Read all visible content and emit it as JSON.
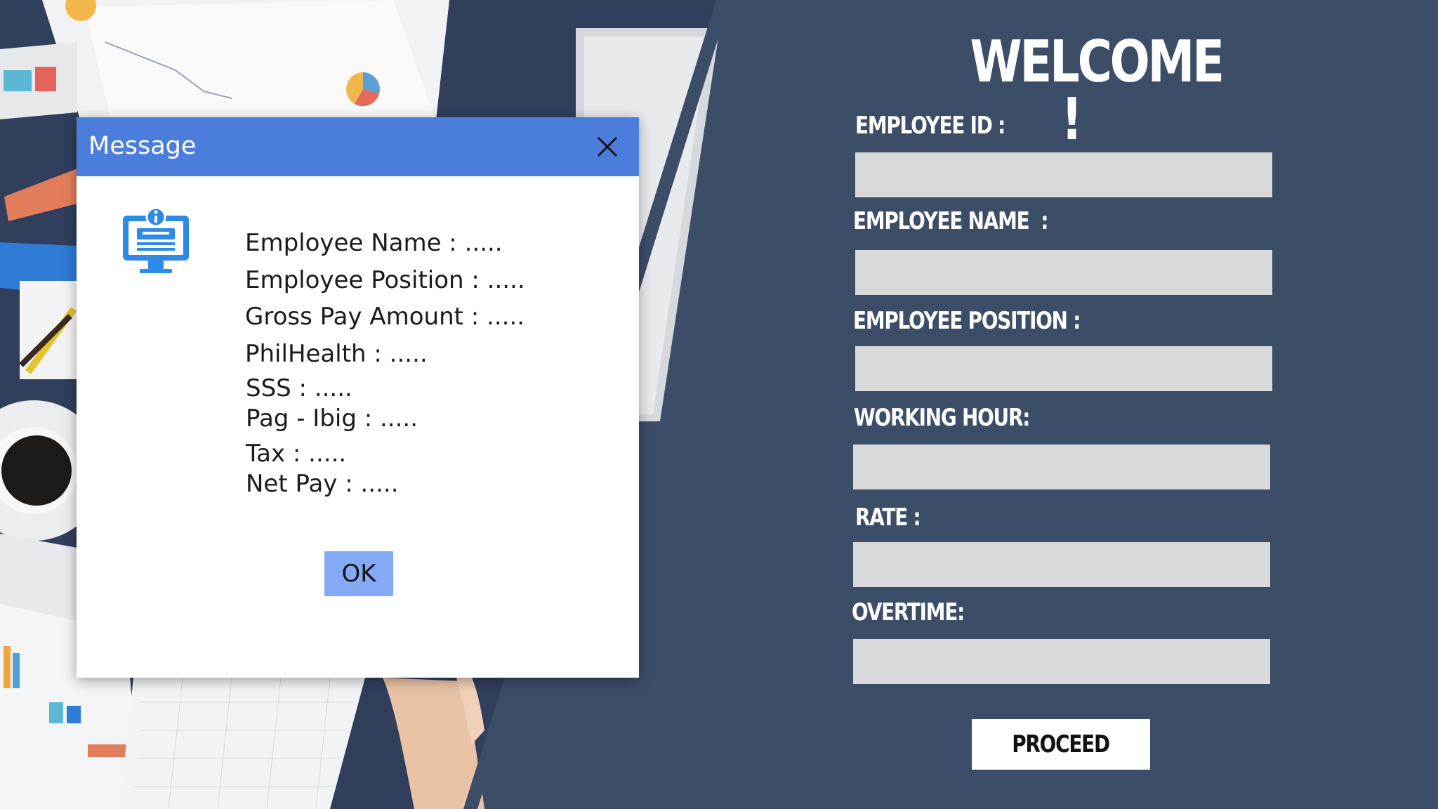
{
  "form": {
    "heading": "WELCOME !",
    "fields": [
      {
        "label": "EMPLOYEE ID :",
        "value": ""
      },
      {
        "label": "EMPLOYEE NAME  :",
        "value": ""
      },
      {
        "label": "EMPLOYEE POSITION :",
        "value": ""
      },
      {
        "label": "WORKING HOUR:",
        "value": ""
      },
      {
        "label": "RATE :",
        "value": ""
      },
      {
        "label": "OVERTIME:",
        "value": ""
      }
    ],
    "proceed_label": "PROCEED"
  },
  "dialog": {
    "title": "Message",
    "icon": "computer-info-icon",
    "lines": [
      "Employee Name : .....",
      "Employee Position : .....",
      "Gross Pay Amount : .....",
      "PhilHealth : .....",
      "SSS : .....",
      "Pag - Ibig : .....",
      "Tax : .....",
      "Net Pay : ....."
    ],
    "ok_label": "OK"
  },
  "colors": {
    "panel_bg": "#3c4d68",
    "dialog_header": "#4a7ddc",
    "ok_button": "#84a9f5",
    "input_bg": "#d9d9d9",
    "icon_blue": "#2d8ae6"
  }
}
